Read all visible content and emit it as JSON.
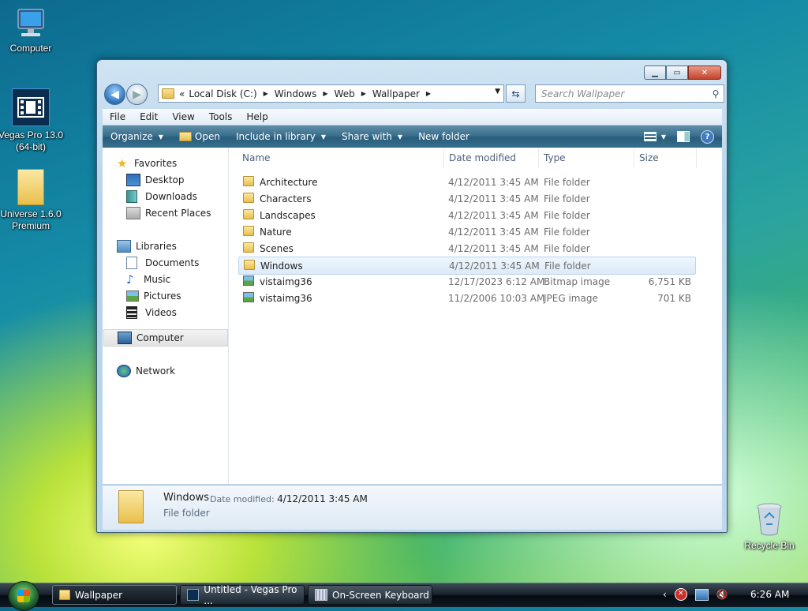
{
  "desktop": {
    "icons": [
      {
        "label": "Computer"
      },
      {
        "label": "Vegas Pro 13.0 (64-bit)"
      },
      {
        "label": "Universe 1.6.0 Premium"
      },
      {
        "label": "Recycle Bin"
      }
    ]
  },
  "window": {
    "address": {
      "overflow": "«",
      "crumbs": [
        "Local Disk (C:)",
        "Windows",
        "Web",
        "Wallpaper"
      ]
    },
    "search_placeholder": "Search Wallpaper",
    "menu": [
      "File",
      "Edit",
      "View",
      "Tools",
      "Help"
    ],
    "commands": {
      "organize": "Organize",
      "open": "Open",
      "include": "Include in library",
      "share": "Share with",
      "new_folder": "New folder"
    },
    "nav": {
      "favorites": "Favorites",
      "desktop": "Desktop",
      "downloads": "Downloads",
      "recent": "Recent Places",
      "libraries": "Libraries",
      "documents": "Documents",
      "music": "Music",
      "pictures": "Pictures",
      "videos": "Videos",
      "computer": "Computer",
      "network": "Network"
    },
    "columns": {
      "name": "Name",
      "date": "Date modified",
      "type": "Type",
      "size": "Size"
    },
    "files": [
      {
        "name": "Architecture",
        "date": "4/12/2011 3:45 AM",
        "type": "File folder",
        "size": ""
      },
      {
        "name": "Characters",
        "date": "4/12/2011 3:45 AM",
        "type": "File folder",
        "size": ""
      },
      {
        "name": "Landscapes",
        "date": "4/12/2011 3:45 AM",
        "type": "File folder",
        "size": ""
      },
      {
        "name": "Nature",
        "date": "4/12/2011 3:45 AM",
        "type": "File folder",
        "size": ""
      },
      {
        "name": "Scenes",
        "date": "4/12/2011 3:45 AM",
        "type": "File folder",
        "size": ""
      },
      {
        "name": "Windows",
        "date": "4/12/2011 3:45 AM",
        "type": "File folder",
        "size": ""
      },
      {
        "name": "vistaimg36",
        "date": "12/17/2023 6:12 AM",
        "type": "Bitmap image",
        "size": "6,751 KB"
      },
      {
        "name": "vistaimg36",
        "date": "11/2/2006 10:03 AM",
        "type": "JPEG image",
        "size": "701 KB"
      }
    ],
    "details": {
      "name": "Windows",
      "date_label": "Date modified:",
      "date_value": "4/12/2011 3:45 AM",
      "type": "File folder"
    }
  },
  "taskbar": {
    "buttons": [
      "Wallpaper",
      "Untitled - Vegas Pro ...",
      "On-Screen Keyboard"
    ],
    "tray_chevron": "‹",
    "clock": "6:26 AM"
  }
}
